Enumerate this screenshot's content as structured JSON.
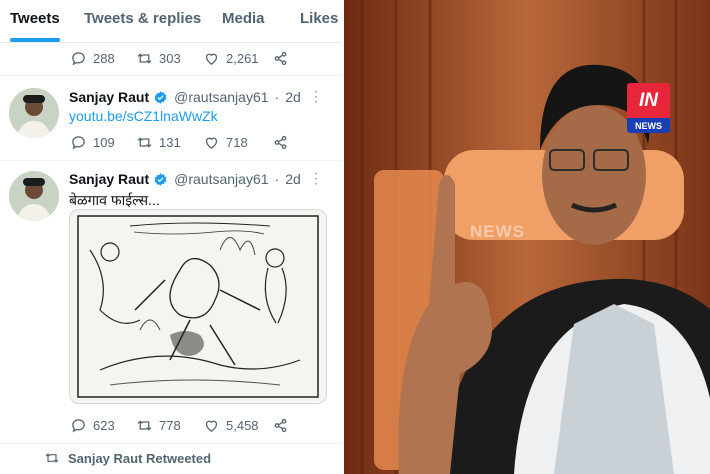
{
  "profile_tabs": [
    "Tweets",
    "Tweets & replies",
    "Media",
    "Likes"
  ],
  "tweet0": {
    "replies": "288",
    "retweets": "303",
    "likes": "2,261"
  },
  "tweet1": {
    "author": "Sanjay Raut",
    "handle": "@rautsanjay61",
    "separator": "·",
    "time": "2d",
    "link_text": "youtu.be/sCZ1lnaWwZk",
    "replies": "109",
    "retweets": "131",
    "likes": "718"
  },
  "tweet2": {
    "author": "Sanjay Raut",
    "handle": "@rautsanjay61",
    "separator": "·",
    "time": "2d",
    "text": "बेळगाव फाईल्स...",
    "replies": "623",
    "retweets": "778",
    "likes": "5,458"
  },
  "retweet_notice": "Sanjay Raut Retweeted",
  "news_badge": {
    "logo": "IN",
    "label": "NEWS"
  },
  "watermark": "NEWS",
  "colors": {
    "accent": "#1d9bf0",
    "badge_red": "#e8263b",
    "badge_blue": "#1a3fb5"
  },
  "icons": [
    "reply-icon",
    "retweet-icon",
    "like-icon",
    "share-icon",
    "verified-badge-icon",
    "more-icon"
  ]
}
